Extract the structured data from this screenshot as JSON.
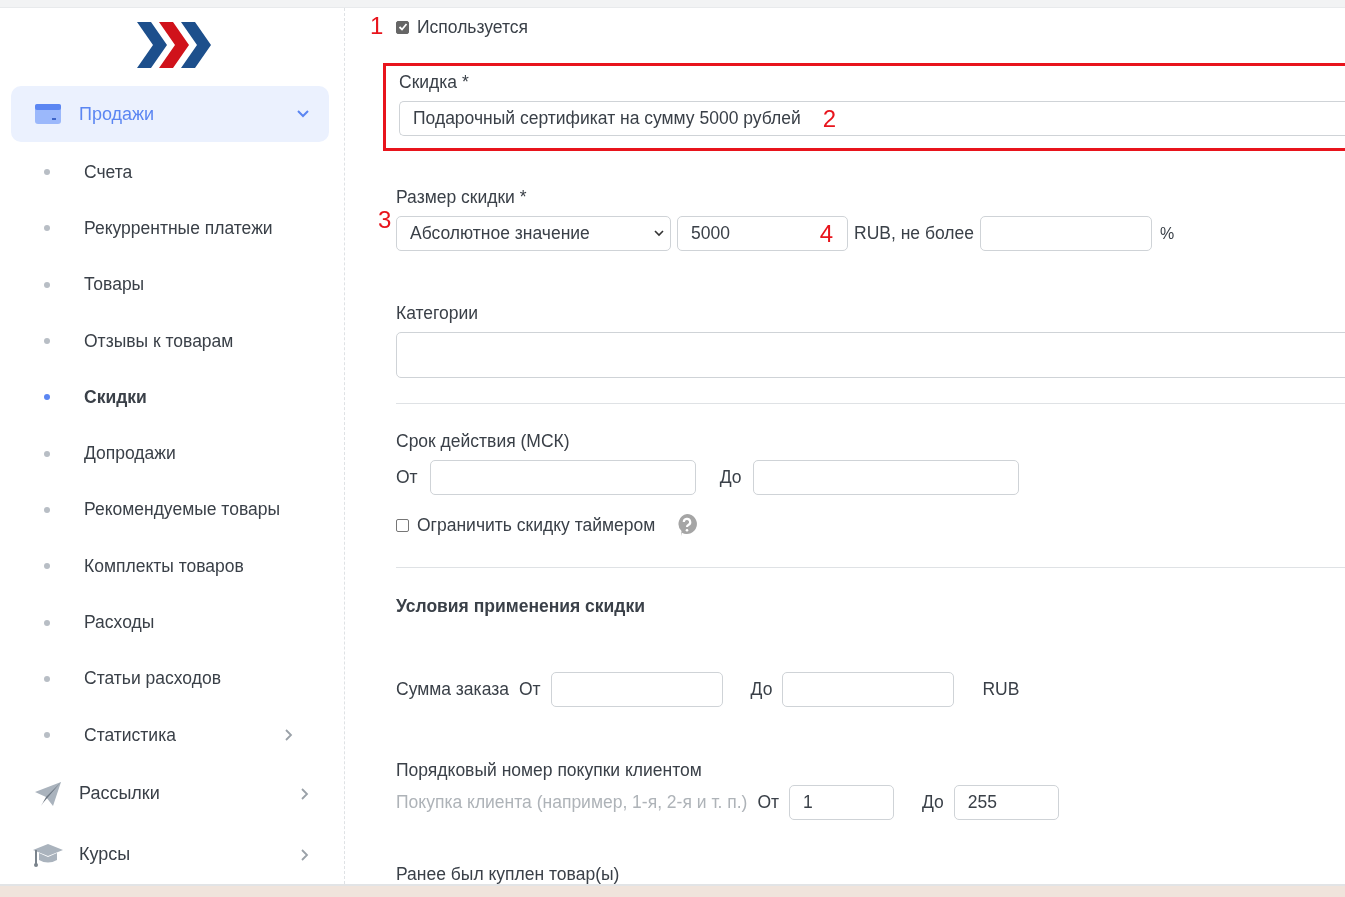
{
  "sidebar": {
    "sections": [
      {
        "label": "Продажи",
        "kind": "card",
        "expanded": true,
        "selected": true,
        "items": [
          {
            "label": "Счета",
            "selected": false,
            "has_children": false
          },
          {
            "label": "Рекуррентные платежи",
            "selected": false,
            "has_children": false
          },
          {
            "label": "Товары",
            "selected": false,
            "has_children": false
          },
          {
            "label": "Отзывы к товарам",
            "selected": false,
            "has_children": false
          },
          {
            "label": "Скидки",
            "selected": true,
            "has_children": false
          },
          {
            "label": "Допродажи",
            "selected": false,
            "has_children": false
          },
          {
            "label": "Рекомендуемые товары",
            "selected": false,
            "has_children": false
          },
          {
            "label": "Комплекты товаров",
            "selected": false,
            "has_children": false
          },
          {
            "label": "Расходы",
            "selected": false,
            "has_children": false
          },
          {
            "label": "Статьи расходов",
            "selected": false,
            "has_children": false
          },
          {
            "label": "Статистика",
            "selected": false,
            "has_children": true
          }
        ]
      },
      {
        "label": "Рассылки",
        "kind": "plane",
        "expanded": false,
        "selected": false
      },
      {
        "label": "Курсы",
        "kind": "cap",
        "expanded": false,
        "selected": false
      }
    ]
  },
  "form": {
    "active": {
      "label": "Используется",
      "checked": true,
      "annotation": "1"
    },
    "discount": {
      "label": "Скидка *",
      "value": "Подарочный сертификат на сумму 5000 рублей",
      "annotation": "2",
      "highlighted": true
    },
    "size": {
      "label": "Размер скидки *",
      "select": "Абсолютное значение",
      "select_annotation": "3",
      "amount": "5000",
      "amount_annotation": "4",
      "unit": "RUB, не более",
      "percent_label": "%"
    },
    "categories": {
      "label": "Категории"
    },
    "validity": {
      "label": "Срок действия (МСК)",
      "from": "От",
      "to": "До"
    },
    "timer": {
      "label": "Ограничить скидку таймером",
      "checked": false
    },
    "conditions": {
      "title": "Условия применения скидки",
      "order_sum": {
        "label": "Сумма заказа",
        "from": "От",
        "to": "До",
        "unit": "RUB"
      },
      "purchase_number": {
        "label": "Порядковый номер покупки клиентом",
        "hint": "Покупка клиента (например, 1-я, 2-я и т. п.)",
        "from": "От",
        "from_value": "1",
        "to": "До",
        "to_value": "255"
      },
      "previous": {
        "label": "Ранее был куплен товар(ы)"
      }
    }
  }
}
